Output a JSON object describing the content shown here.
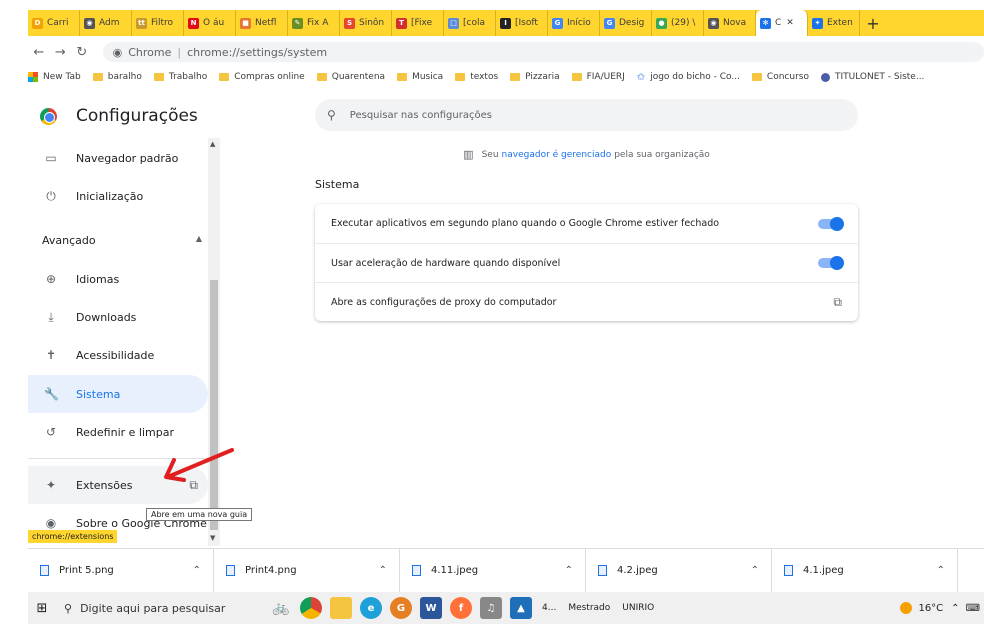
{
  "tabs": [
    {
      "label": "Carri",
      "color": "#f4a200",
      "glyph": "D"
    },
    {
      "label": "Adm",
      "color": "#555555",
      "glyph": "◉"
    },
    {
      "label": "Filtro",
      "color": "#c79a2e",
      "glyph": "tt"
    },
    {
      "label": "O áu",
      "color": "#e50914",
      "glyph": "N"
    },
    {
      "label": "Netfl",
      "color": "#e8772e",
      "glyph": "■"
    },
    {
      "label": "Fix A",
      "color": "#6b8e23",
      "glyph": "✎"
    },
    {
      "label": "Sinôn",
      "color": "#e8452e",
      "glyph": "S"
    },
    {
      "label": "[Fixe",
      "color": "#d32f2f",
      "glyph": "T"
    },
    {
      "label": "[cola",
      "color": "#5b8ad8",
      "glyph": "□"
    },
    {
      "label": "[Isoft",
      "color": "#222222",
      "glyph": "I"
    },
    {
      "label": "Início",
      "color": "#4285f4",
      "glyph": "G"
    },
    {
      "label": "Desig",
      "color": "#4285f4",
      "glyph": "G"
    },
    {
      "label": "(29) \\",
      "color": "#3aa757",
      "glyph": "●"
    },
    {
      "label": "Nova",
      "color": "#555555",
      "glyph": "◉"
    },
    {
      "label": "C",
      "color": "#1a73e8",
      "glyph": "✻",
      "active": true
    },
    {
      "label": "Exten",
      "color": "#1a73e8",
      "glyph": "✦"
    }
  ],
  "new_tab": "+",
  "close_glyph": "✕",
  "toolbar": {
    "back": "←",
    "forward": "→",
    "reload": "↻",
    "site": "Chrome",
    "url": "chrome://settings/system"
  },
  "bookmarks": [
    "New Tab",
    "baralho",
    "Trabalho",
    "Compras online",
    "Quarentena",
    "Musica",
    "textos",
    "Pizzaria",
    "FIA/UERJ",
    "jogo do bicho - Co...",
    "Concurso",
    "TITULONET - Siste..."
  ],
  "app_title": "Configurações",
  "sidebar": {
    "items": [
      {
        "label": "Navegador padrão",
        "icon": "▭"
      },
      {
        "label": "Inicialização",
        "icon": "⏻"
      },
      {
        "label": "Idiomas",
        "icon": "⊕"
      },
      {
        "label": "Downloads",
        "icon": "⤓"
      },
      {
        "label": "Acessibilidade",
        "icon": "✝"
      },
      {
        "label": "Sistema",
        "icon": "🔧"
      },
      {
        "label": "Redefinir e limpar",
        "icon": "↺"
      },
      {
        "label": "Extensões",
        "icon": "✦"
      },
      {
        "label": "Sobre o Google Chrome",
        "icon": "◉"
      }
    ],
    "advanced_label": "Avançado",
    "advanced_chevron": "▲",
    "ext_link_icon": "⧉"
  },
  "search": {
    "placeholder": "Pesquisar nas configurações"
  },
  "managed": {
    "pre": "Seu",
    "link": "navegador é gerenciado",
    "post": "pela sua organização"
  },
  "section_title": "Sistema",
  "settings": [
    {
      "label": "Executar aplicativos em segundo plano quando o Google Chrome estiver fechado",
      "enabled": true
    },
    {
      "label": "Usar aceleração de hardware quando disponível",
      "enabled": true
    },
    {
      "label": "Abre as configurações de proxy do computador"
    }
  ],
  "tooltip": "Abre em uma nova guia",
  "status_url": "chrome://extensions",
  "downloads": [
    "Print 5.png",
    "Print4.png",
    "4.11.jpeg",
    "4.2.jpeg",
    "4.1.jpeg"
  ],
  "taskbar": {
    "search_placeholder": "Digite aqui para pesquisar",
    "items": [
      "4...",
      "Mestrado",
      "UNIRIO"
    ],
    "temperature": "16°C"
  }
}
